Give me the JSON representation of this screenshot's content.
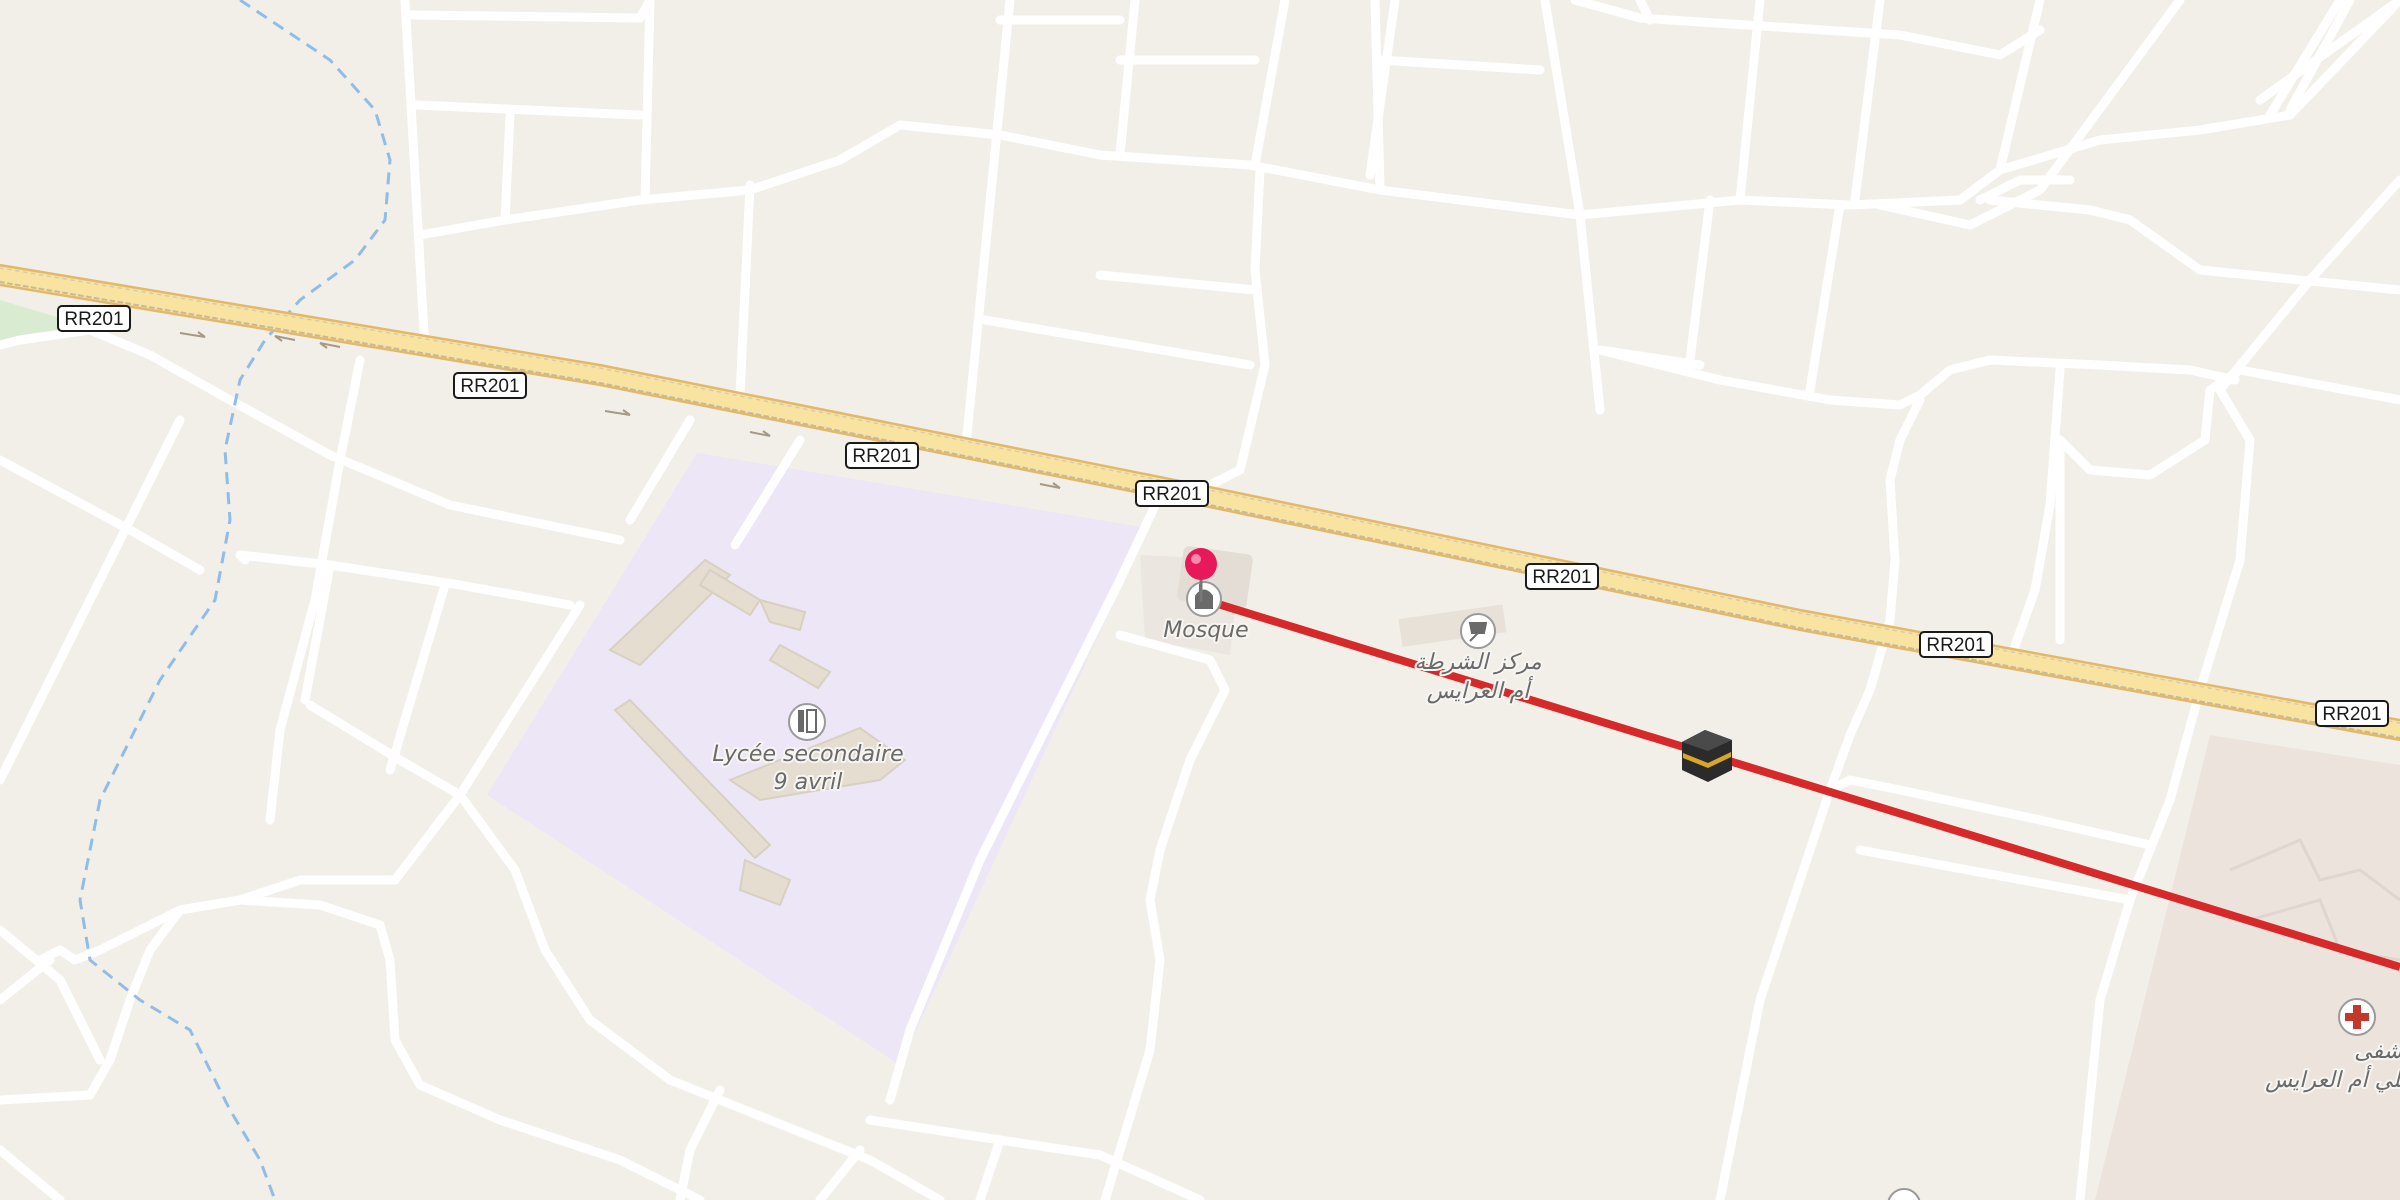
{
  "map": {
    "road_ref": "RR201",
    "pois": {
      "mosque": {
        "label": "Mosque",
        "icon": "mosque-icon"
      },
      "school": {
        "label_line1": "Lycée secondaire",
        "label_line2": "9 avril",
        "icon": "school-icon"
      },
      "police": {
        "label_line1": "مركز الشرطة",
        "label_line2": "أم العرايس",
        "icon": "police-icon"
      },
      "hospital": {
        "label_line1": "المستشفى",
        "label_line2": "المحلي أم العرايس",
        "icon": "hospital-icon"
      }
    },
    "markers": {
      "location_pin": "pin-icon",
      "qibla": "kaaba-icon"
    },
    "colors": {
      "background": "#f2efe9",
      "road": "#ffffff",
      "primary_road": "#f8e3a0",
      "school_area": "#ece6f7",
      "hospital_area": "#ece2dc",
      "qibla_line": "#d62a2a",
      "pin": "#e8195a",
      "stream": "#8fbde8"
    }
  }
}
